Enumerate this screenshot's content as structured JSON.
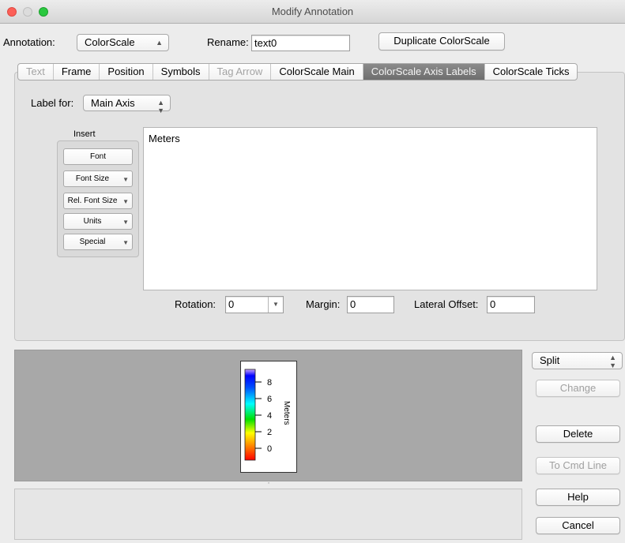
{
  "window": {
    "title": "Modify Annotation"
  },
  "header": {
    "annotation_label": "Annotation:",
    "annotation_value": "ColorScale",
    "rename_label": "Rename:",
    "rename_value": "text0",
    "duplicate_button": "Duplicate ColorScale"
  },
  "tabs": [
    {
      "label": "Text",
      "state": "disabled"
    },
    {
      "label": "Frame",
      "state": "normal"
    },
    {
      "label": "Position",
      "state": "normal"
    },
    {
      "label": "Symbols",
      "state": "normal"
    },
    {
      "label": "Tag Arrow",
      "state": "disabled"
    },
    {
      "label": "ColorScale Main",
      "state": "normal"
    },
    {
      "label": "ColorScale Axis Labels",
      "state": "selected"
    },
    {
      "label": "ColorScale Ticks",
      "state": "normal"
    }
  ],
  "panel": {
    "label_for_label": "Label for:",
    "label_for_value": "Main Axis",
    "insert": {
      "title": "Insert",
      "buttons": [
        "Font",
        "Font Size",
        "Rel. Font Size",
        "Units",
        "Special"
      ]
    },
    "text_content": "Meters",
    "rotation_label": "Rotation:",
    "rotation_value": "0",
    "margin_label": "Margin:",
    "margin_value": "0",
    "lateral_offset_label": "Lateral Offset:",
    "lateral_offset_value": "0"
  },
  "preview": {
    "axis_label": "Meters",
    "ticks": [
      "8",
      "6",
      "4",
      "2",
      "0"
    ]
  },
  "side": {
    "split_value": "Split",
    "change": "Change",
    "delete": "Delete",
    "to_cmd_line": "To Cmd Line",
    "help": "Help",
    "cancel": "Cancel"
  },
  "colors": {
    "selected_tab": "#7a7a7a",
    "preview_bg": "#a8a8a8"
  }
}
